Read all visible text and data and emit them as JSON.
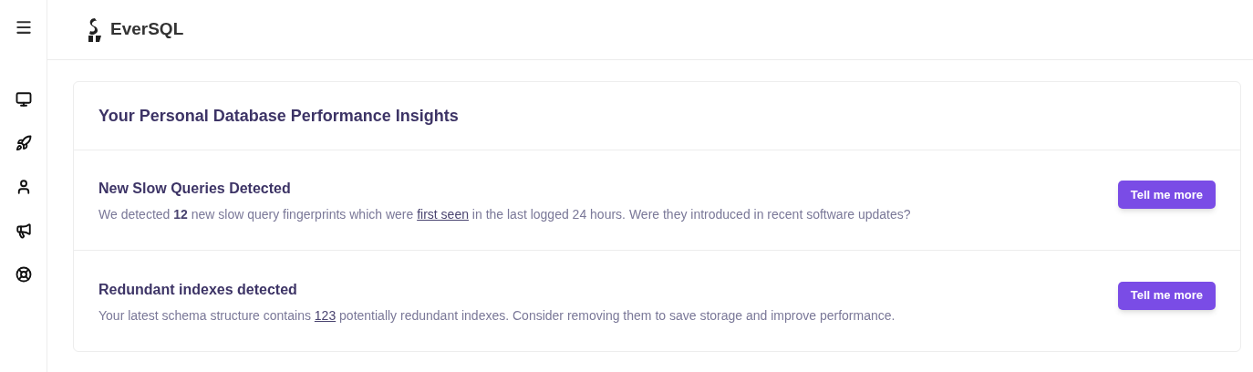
{
  "sidebar": {
    "items": [
      {
        "kind": "monitor"
      },
      {
        "kind": "rocket"
      },
      {
        "kind": "user"
      },
      {
        "kind": "megaphone"
      },
      {
        "kind": "lifebuoy"
      }
    ]
  },
  "header": {
    "brand": "EverSQL"
  },
  "card": {
    "title": "Your Personal Database Performance Insights",
    "insights": [
      {
        "title": "New Slow Queries Detected",
        "description": [
          {
            "kind": "text",
            "text": "We detected "
          },
          {
            "kind": "bold",
            "text": "12"
          },
          {
            "kind": "text",
            "text": " new slow query fingerprints which were "
          },
          {
            "kind": "link",
            "text": "first seen"
          },
          {
            "kind": "text",
            "text": " in the last logged 24 hours. Were they introduced in recent software updates?"
          }
        ],
        "button": "Tell me more"
      },
      {
        "title": "Redundant indexes detected",
        "description": [
          {
            "kind": "text",
            "text": "Your latest schema structure contains "
          },
          {
            "kind": "link",
            "text": "123"
          },
          {
            "kind": "text",
            "text": " potentially redundant indexes. Consider removing them to save storage and improve performance."
          }
        ],
        "button": "Tell me more"
      }
    ]
  }
}
